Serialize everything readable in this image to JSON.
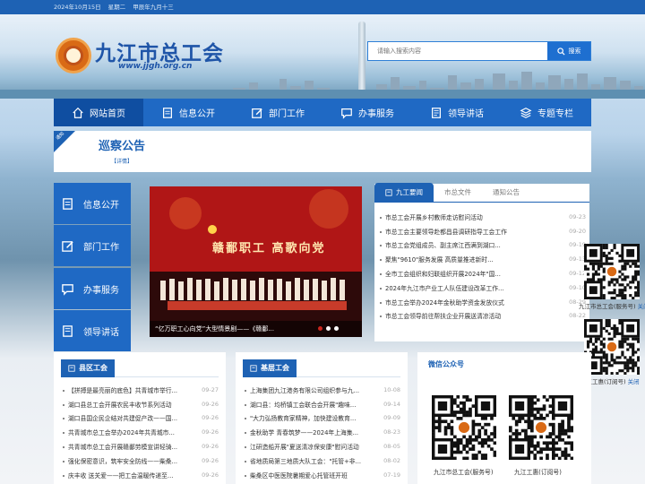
{
  "topbar": {
    "date": "2024年10月15日",
    "weekday": "星期二",
    "lunar": "甲辰年九月十三"
  },
  "header": {
    "site_name": "九江市总工会",
    "site_url": "www.jjgh.org.cn"
  },
  "search": {
    "placeholder": "请输入搜索内容",
    "button": "搜索"
  },
  "nav": [
    {
      "label": "网站首页",
      "icon": "home-icon"
    },
    {
      "label": "信息公开",
      "icon": "document-icon"
    },
    {
      "label": "部门工作",
      "icon": "edit-icon"
    },
    {
      "label": "办事服务",
      "icon": "chat-icon"
    },
    {
      "label": "领导讲话",
      "icon": "file-icon"
    },
    {
      "label": "专题专栏",
      "icon": "layers-icon"
    }
  ],
  "notice": {
    "tag": "通知",
    "title": "巡察公告",
    "detail": "【详情】"
  },
  "sidebar": [
    {
      "label": "信息公开",
      "icon": "document-icon"
    },
    {
      "label": "部门工作",
      "icon": "edit-icon"
    },
    {
      "label": "办事服务",
      "icon": "chat-icon"
    },
    {
      "label": "领导讲话",
      "icon": "file-icon"
    }
  ],
  "slider": {
    "caption": "“亿万职工心向党”大型情景剧——《赣鄱...",
    "stage_text": "赣鄱职工 高歌向党"
  },
  "news_tabs": [
    "九工要闻",
    "市总文件",
    "通知公告"
  ],
  "news": [
    {
      "title": "市总工会开展乡村教师走访慰问活动",
      "date": "09-23"
    },
    {
      "title": "市总工会主要领导赴都昌县调研指导工会工作",
      "date": "09-20"
    },
    {
      "title": "市总工会党组成员、副主席江西满到湖口...",
      "date": "09-19"
    },
    {
      "title": "聚焦\"9610\"服务发展 高质量推进新时...",
      "date": "09-13"
    },
    {
      "title": "全市工会组织和妇联组织开展2024年\"国...",
      "date": "09-12"
    },
    {
      "title": "2024年九江市产业工人队伍建设改革工作...",
      "date": "09-10"
    },
    {
      "title": "市总工会举办2024年金秋助学资金发放仪式",
      "date": "08-29"
    },
    {
      "title": "市总工会领导前往帮扶企业开展送清凉活动",
      "date": "08-22"
    }
  ],
  "qr_side": [
    {
      "label": "九江市总工会(服务号)",
      "link": "关闭"
    },
    {
      "label": "九江工惠(订阅号)",
      "link": "关闭"
    }
  ],
  "county": {
    "title": "县区工会",
    "items": [
      {
        "title": "【拼搏是最亮丽的底色】共青城市举行...",
        "date": "09-27"
      },
      {
        "title": "湖口县总工会开展农民丰收节系列活动",
        "date": "09-26"
      },
      {
        "title": "湖口县国企民企结对共建促产改——国...",
        "date": "09-26"
      },
      {
        "title": "共青城市总工会举办2024年共青城市...",
        "date": "09-26"
      },
      {
        "title": "共青城市总工会开展赣鄱劳模宣讲轻骑...",
        "date": "09-26"
      },
      {
        "title": "强化保密意识，筑牢安全防线——柴桑...",
        "date": "09-26"
      },
      {
        "title": "庆丰收 送关爱——把工会温暖传递至...",
        "date": "09-26"
      }
    ]
  },
  "grassroots": {
    "title": "基层工会",
    "items": [
      {
        "title": "上海集团九江港务有限公司组织参与九...",
        "date": "10-08"
      },
      {
        "title": "湖口县：均桥镇工会联合会开展\"趣味...",
        "date": "09-14"
      },
      {
        "title": "\"大力弘扬教育家精神，加快建设教育...",
        "date": "09-09"
      },
      {
        "title": "金秋助学 青春筑梦——2024年上海集...",
        "date": "08-23"
      },
      {
        "title": "江研造船开展\"夏送清凉保安康\"慰问活动",
        "date": "08-05"
      },
      {
        "title": "省地质局第三地质大队工会：\"托管+非...",
        "date": "08-02"
      },
      {
        "title": "柴桑区中医医院暑期爱心托管班开班",
        "date": "07-19"
      }
    ]
  },
  "wechat": {
    "title": "微信公众号",
    "items": [
      {
        "label": "九江市总工会(服务号)"
      },
      {
        "label": "九江工惠(订阅号)"
      }
    ]
  },
  "colors": {
    "primary": "#1e62b4",
    "nav_active": "#0f4ea1",
    "accent_red": "#c8261e",
    "logo_orange": "#d96a16"
  }
}
